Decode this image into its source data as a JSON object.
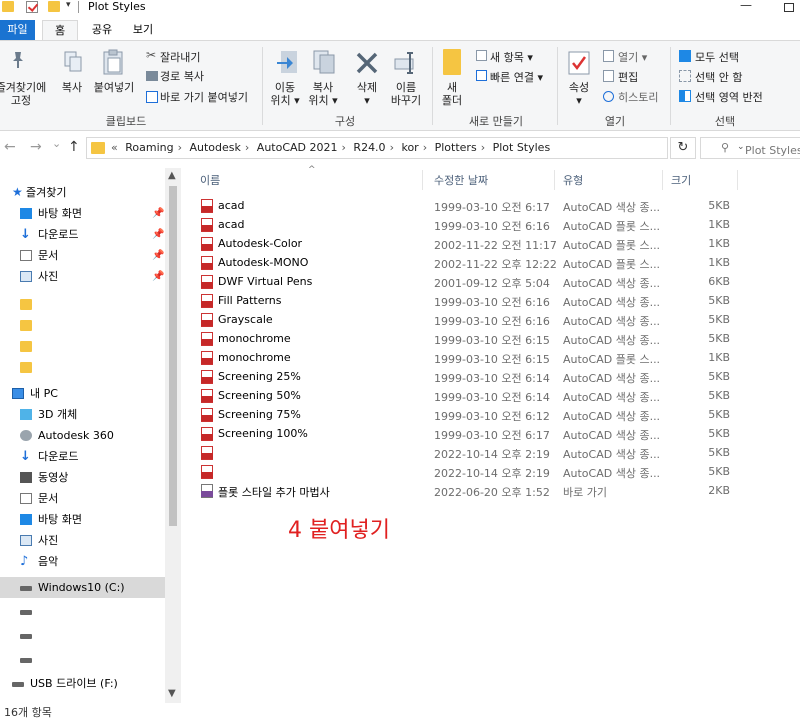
{
  "window": {
    "title": "Plot Styles",
    "qat_arrow": "▾",
    "minimize": "—"
  },
  "ribbon_tabs": [
    "파일",
    "홈",
    "공유",
    "보기"
  ],
  "ribbon": {
    "clipboard": {
      "pin_label_1": "즐겨찾기에",
      "pin_label_2": "고정",
      "copy": "복사",
      "paste": "붙여넣기",
      "cut": "잘라내기",
      "copy_path": "경로 복사",
      "paste_shortcut": "바로 가기 붙여넣기",
      "group": "클립보드"
    },
    "organize": {
      "move_1": "이동",
      "move_2": "위치 ▾",
      "copyto_1": "복사",
      "copyto_2": "위치 ▾",
      "delete": "삭제",
      "delete_arrow": "▾",
      "rename_1": "이름",
      "rename_2": "바꾸기",
      "group": "구성"
    },
    "new": {
      "new_folder_1": "새",
      "new_folder_2": "폴더",
      "new_item": "새 항목 ▾",
      "easy_access": "빠른 연결 ▾",
      "group": "새로 만들기"
    },
    "open": {
      "properties": "속성",
      "properties_arrow": "▾",
      "open": "열기 ▾",
      "edit": "편집",
      "history": "히스토리",
      "group": "열기"
    },
    "select": {
      "select_all": "모두 선택",
      "select_none": "선택 안 함",
      "invert": "선택 영역 반전",
      "group": "선택"
    }
  },
  "address": {
    "back": "←",
    "forward": "→",
    "recent": "⌄",
    "up": "↑",
    "overflow": "«",
    "crumbs": [
      "Roaming",
      "Autodesk",
      "AutoCAD 2021",
      "R24.0",
      "kor",
      "Plotters",
      "Plot Styles"
    ],
    "separator": "›",
    "dropdown": "⌄",
    "refresh": "↻",
    "search_icon": "⚲",
    "search_placeholder": "Plot Styles 검색"
  },
  "nav": {
    "quick_access": "즐겨찾기",
    "quick_items": [
      "바탕 화면",
      "다운로드",
      "문서",
      "사진"
    ],
    "pin_glyph": "📌",
    "this_pc": "내 PC",
    "pc_items": [
      "3D 개체",
      "Autodesk 360",
      "다운로드",
      "동영상",
      "문서",
      "바탕 화면",
      "사진",
      "음악",
      "Windows10 (C:)"
    ],
    "usb": "USB 드라이브 (F:)"
  },
  "columns": {
    "name": "이름",
    "date": "수정한 날짜",
    "type": "유형",
    "size": "크기",
    "sort_caret": "^"
  },
  "files": [
    {
      "name": "acad",
      "date": "1999-03-10 오전 6:17",
      "type": "AutoCAD 색상 종...",
      "size": "5KB",
      "icon": "ctb"
    },
    {
      "name": "acad",
      "date": "1999-03-10 오전 6:16",
      "type": "AutoCAD 플롯 스...",
      "size": "1KB",
      "icon": "stb"
    },
    {
      "name": "Autodesk-Color",
      "date": "2002-11-22 오전 11:17",
      "type": "AutoCAD 플롯 스...",
      "size": "1KB",
      "icon": "stb"
    },
    {
      "name": "Autodesk-MONO",
      "date": "2002-11-22 오후 12:22",
      "type": "AutoCAD 플롯 스...",
      "size": "1KB",
      "icon": "stb"
    },
    {
      "name": "DWF Virtual Pens",
      "date": "2001-09-12 오후 5:04",
      "type": "AutoCAD 색상 종...",
      "size": "6KB",
      "icon": "ctb"
    },
    {
      "name": "Fill Patterns",
      "date": "1999-03-10 오전 6:16",
      "type": "AutoCAD 색상 종...",
      "size": "5KB",
      "icon": "ctb"
    },
    {
      "name": "Grayscale",
      "date": "1999-03-10 오전 6:16",
      "type": "AutoCAD 색상 종...",
      "size": "5KB",
      "icon": "ctb"
    },
    {
      "name": "monochrome",
      "date": "1999-03-10 오전 6:15",
      "type": "AutoCAD 색상 종...",
      "size": "5KB",
      "icon": "ctb"
    },
    {
      "name": "monochrome",
      "date": "1999-03-10 오전 6:15",
      "type": "AutoCAD 플롯 스...",
      "size": "1KB",
      "icon": "stb"
    },
    {
      "name": "Screening 25%",
      "date": "1999-03-10 오전 6:14",
      "type": "AutoCAD 색상 종...",
      "size": "5KB",
      "icon": "ctb"
    },
    {
      "name": "Screening 50%",
      "date": "1999-03-10 오전 6:14",
      "type": "AutoCAD 색상 종...",
      "size": "5KB",
      "icon": "ctb"
    },
    {
      "name": "Screening 75%",
      "date": "1999-03-10 오전 6:12",
      "type": "AutoCAD 색상 종...",
      "size": "5KB",
      "icon": "ctb"
    },
    {
      "name": "Screening 100%",
      "date": "1999-03-10 오전 6:17",
      "type": "AutoCAD 색상 종...",
      "size": "5KB",
      "icon": "ctb"
    },
    {
      "name": "",
      "date": "2022-10-14 오후 2:19",
      "type": "AutoCAD 색상 종...",
      "size": "5KB",
      "icon": "ctb"
    },
    {
      "name": "",
      "date": "2022-10-14 오후 2:19",
      "type": "AutoCAD 색상 종...",
      "size": "5KB",
      "icon": "ctb"
    },
    {
      "name": "플롯 스타일 추가 마법사",
      "date": "2022-06-20 오후 1:52",
      "type": "바로 가기",
      "size": "2KB",
      "icon": "shortcut"
    }
  ],
  "annotation": "4 붙여넣기",
  "status": {
    "count": "16개 항목"
  },
  "colors": {
    "file_tab": "#1a73d1",
    "accent": "#1e6fd9",
    "annotation": "#e02020"
  }
}
